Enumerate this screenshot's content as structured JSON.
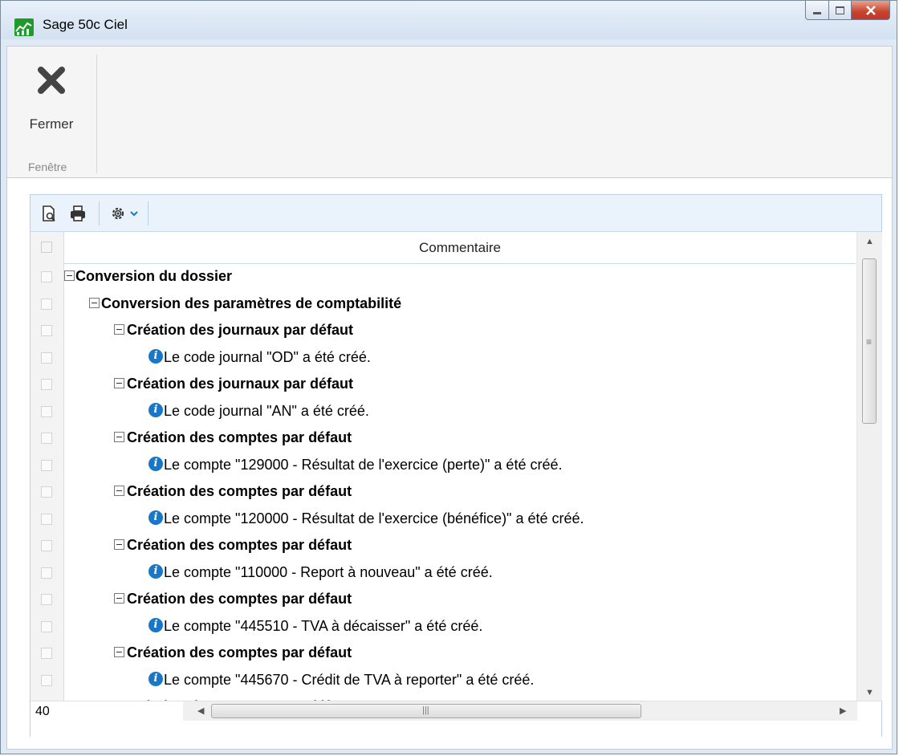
{
  "window": {
    "title": "Sage 50c Ciel",
    "buttons": [
      "minimize-icon",
      "maximize-icon",
      "close-icon"
    ]
  },
  "ribbon": {
    "close_label": "Fermer",
    "group_label": "Fenêtre"
  },
  "toolbar": {
    "icons": [
      "preview-icon",
      "print-icon",
      "settings-icon",
      "chevron-down-icon"
    ]
  },
  "grid": {
    "column_header": "Commentaire",
    "rows": [
      {
        "level": 0,
        "type": "group",
        "text": "Conversion du dossier"
      },
      {
        "level": 1,
        "type": "group",
        "text": "Conversion des paramètres de comptabilité"
      },
      {
        "level": 2,
        "type": "group",
        "text": "Création des journaux par défaut"
      },
      {
        "level": 3,
        "type": "info",
        "text": "Le code journal \"OD\" a été créé."
      },
      {
        "level": 2,
        "type": "group",
        "text": "Création des journaux par défaut"
      },
      {
        "level": 3,
        "type": "info",
        "text": "Le code journal \"AN\" a été créé."
      },
      {
        "level": 2,
        "type": "group",
        "text": "Création des comptes par défaut"
      },
      {
        "level": 3,
        "type": "info",
        "text": "Le compte \"129000 - Résultat de l'exercice (perte)\" a été créé."
      },
      {
        "level": 2,
        "type": "group",
        "text": "Création des comptes par défaut"
      },
      {
        "level": 3,
        "type": "info",
        "text": "Le compte \"120000 - Résultat de l'exercice (bénéfice)\" a été créé."
      },
      {
        "level": 2,
        "type": "group",
        "text": "Création des comptes par défaut"
      },
      {
        "level": 3,
        "type": "info",
        "text": "Le compte \"110000 - Report à nouveau\" a été créé."
      },
      {
        "level": 2,
        "type": "group",
        "text": "Création des comptes par défaut"
      },
      {
        "level": 3,
        "type": "info",
        "text": "Le compte \"445510 - TVA à décaisser\" a été créé."
      },
      {
        "level": 2,
        "type": "group",
        "text": "Création des comptes par défaut"
      },
      {
        "level": 3,
        "type": "info",
        "text": "Le compte \"445670 - Crédit de TVA à reporter\" a été créé."
      },
      {
        "level": 2,
        "type": "group",
        "text": "Création des comptes par défaut"
      }
    ],
    "row_count": "40"
  },
  "colors": {
    "info_icon": "#1877c9",
    "toolbar_bg": "#eaf3fb",
    "app_icon": "#1f9b2c"
  }
}
